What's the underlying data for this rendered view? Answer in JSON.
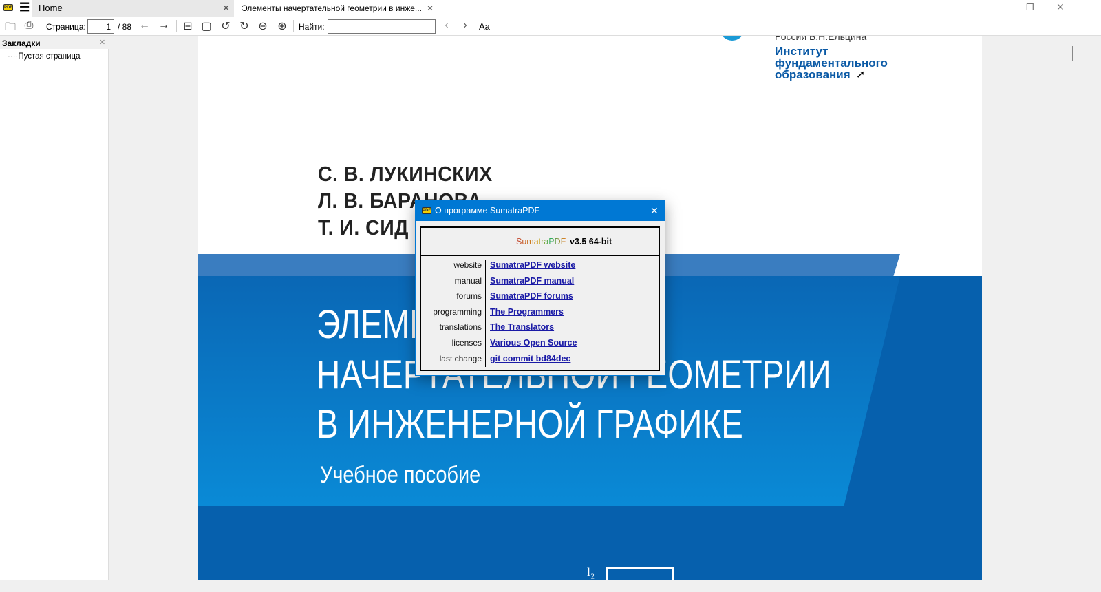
{
  "titlebar": {
    "tabs": [
      {
        "label": "Home"
      },
      {
        "label": "Элементы  начертательной  геометрии  в  инже..."
      }
    ]
  },
  "toolbar": {
    "page_label": "Страница:",
    "page_value": "1",
    "page_total": "/ 88",
    "find_label": "Найти:",
    "find_value": "",
    "font_btn": "Aa"
  },
  "sidebar": {
    "title": "Закладки",
    "items": [
      {
        "label": "Пустая страница"
      }
    ]
  },
  "document": {
    "institute": [
      "Институт",
      "фундаментального",
      "образования"
    ],
    "header_top": "России Б.Н.Ельцина",
    "authors": [
      "С. В. ЛУКИНСКИХ",
      "Л. В. БАРАНОВА",
      "Т. И. СИД"
    ],
    "title": [
      "ЭЛЕМЕНТЫ",
      "НАЧЕРТАТЕЛЬНОЙ ГЕОМЕТРИИ",
      "В ИНЖЕНЕРНОЙ ГРАФИКЕ"
    ],
    "subtitle": "Учебное пособие",
    "figure_label": "l₂"
  },
  "dialog": {
    "title": "О программе SumatraPDF",
    "app_name": "SumatraPDF",
    "version": "v3.5 64-bit",
    "rows": [
      {
        "label": "website",
        "link": "SumatraPDF website"
      },
      {
        "label": "manual",
        "link": "SumatraPDF manual"
      },
      {
        "label": "forums",
        "link": "SumatraPDF forums"
      },
      {
        "label": "programming",
        "link": "The Programmers"
      },
      {
        "label": "translations",
        "link": "The Translators"
      },
      {
        "label": "licenses",
        "link": "Various Open Source"
      },
      {
        "label": "last change",
        "link": "git commit bd84dec"
      }
    ]
  },
  "colors": {
    "accent": "#0078d4",
    "link": "#1a1aa6",
    "cover_blue": "#0a6ab8"
  }
}
